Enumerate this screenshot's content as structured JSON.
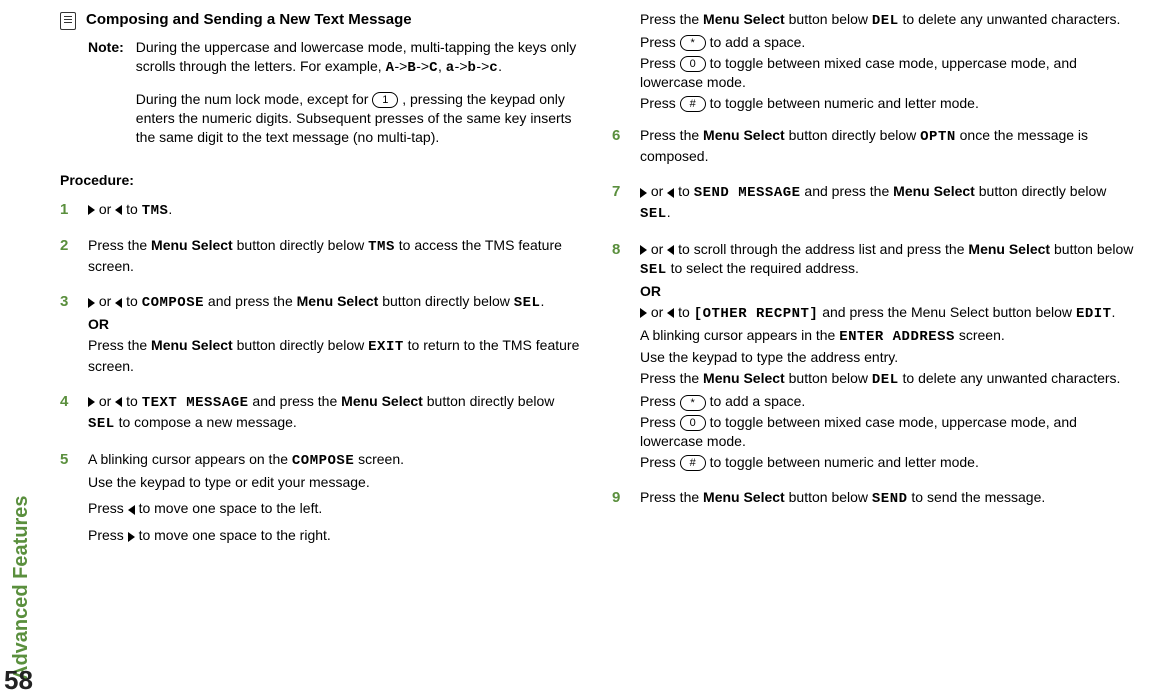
{
  "side_label": "Advanced Features",
  "page_number": "58",
  "heading": "Composing and Sending a New Text Message",
  "note_label": "Note:",
  "note_p1_a": "During the uppercase and lowercase mode, multi-tapping the keys only scrolls through the letters. For example, ",
  "note_seq1": "A",
  "note_seq2": "B",
  "note_seq3": "C",
  "note_seq4": "a",
  "note_seq5": "b",
  "note_seq6": "c",
  "note_arrow": "->",
  "note_sep": ", ",
  "note_period": ".",
  "note_p2_a": "During the num lock mode, except for ",
  "note_key1": "1",
  "note_p2_b": ", pressing the keypad only enters the numeric digits. Subsequent presses of the same key inserts the same digit to the text message (no multi-tap).",
  "procedure_label": "Procedure:",
  "step1": {
    "num": "1",
    "or": " or ",
    "to": " to ",
    "tms": "TMS",
    "end": "."
  },
  "step2": {
    "num": "2",
    "a": "Press the ",
    "ms": "Menu Select",
    "b": " button directly below ",
    "tms": "TMS",
    "c": " to access the TMS feature screen."
  },
  "step3": {
    "num": "3",
    "or": " or ",
    "to": " to ",
    "compose": "COMPOSE",
    "a": " and press the ",
    "ms": "Menu Select",
    "b": " button directly below ",
    "sel": "SEL",
    "end": ".",
    "OR": "OR",
    "c": "Press the ",
    "d": " button directly below ",
    "exit": "EXIT",
    "e": " to return to the TMS feature screen."
  },
  "step4": {
    "num": "4",
    "or": " or ",
    "to": " to ",
    "tm": "TEXT MESSAGE",
    "a": " and press the ",
    "ms": "Menu Select",
    "b": " button directly below ",
    "sel": "SEL",
    "c": " to compose a new message."
  },
  "step5": {
    "num": "5",
    "a": "A blinking cursor appears on the ",
    "compose": "COMPOSE",
    "b": " screen.",
    "c": "Use the keypad to type or edit your message.",
    "d": "Press ",
    "e": " to move one space to the left.",
    "f": " to move one space to the right."
  },
  "col2_cont": {
    "a": "Press the ",
    "ms": "Menu Select",
    "b": " button below ",
    "del": "DEL",
    "c": " to delete any unwanted characters.",
    "d": "Press ",
    "star": "*",
    "e": " to add a space.",
    "zero": "0",
    "f": " to toggle between mixed case mode, uppercase mode, and lowercase mode.",
    "hash": "#",
    "g": " to toggle between numeric and letter mode."
  },
  "step6": {
    "num": "6",
    "a": "Press the ",
    "ms": "Menu Select",
    "b": " button directly below ",
    "optn": "OPTN",
    "c": " once the message is composed."
  },
  "step7": {
    "num": "7",
    "or": " or ",
    "to": " to ",
    "sm": "SEND MESSAGE",
    "a": " and press the ",
    "ms": "Menu Select",
    "b": " button directly below ",
    "sel": "SEL",
    "end": "."
  },
  "step8": {
    "num": "8",
    "or": " or ",
    "a": " to scroll through the address list and press the ",
    "ms": "Menu Select",
    "b": " button below ",
    "sel": "SEL",
    "c": " to select the required address.",
    "OR": "OR",
    "to": " to ",
    "other": "[OTHER RECPNT]",
    "d": " and press the Menu Select button below ",
    "edit": "EDIT",
    "end": ".",
    "e": "A blinking cursor appears in the ",
    "ea": "ENTER ADDRESS",
    "f": " screen.",
    "g": "Use the keypad to type the address entry.",
    "h": "Press the ",
    "i": " button below ",
    "del": "DEL",
    "j": " to delete any unwanted characters.",
    "k": "Press ",
    "star": "*",
    "l": " to add a space.",
    "zero": "0",
    "m": " to toggle between mixed case mode, uppercase mode, and lowercase mode.",
    "hash": "#",
    "n": " to toggle between numeric and letter mode."
  },
  "step9": {
    "num": "9",
    "a": "Press the ",
    "ms": "Menu Select",
    "b": " button below ",
    "send": "SEND",
    "c": " to send the message."
  }
}
